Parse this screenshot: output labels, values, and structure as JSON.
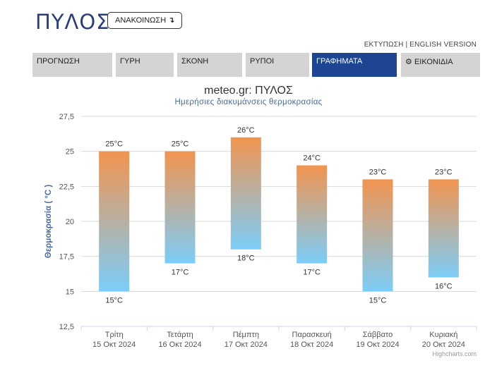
{
  "header": {
    "title": "ΠΥΛΟΣ",
    "announce_label": "ΑΝΑΚΟΙΝΩΣΗ",
    "announce_arrow": "↴"
  },
  "top_links": {
    "print": "ΕΚΤΥΠΩΣΗ",
    "separator": "|",
    "english": "ENGLISH VERSION"
  },
  "tabs": [
    {
      "label": "ΠΡΟΓΝΩΣΗ",
      "active": false
    },
    {
      "label": "ΓΥΡΗ",
      "active": false
    },
    {
      "label": "ΣΚΟΝΗ",
      "active": false
    },
    {
      "label": "ΡΥΠΟΙ",
      "active": false
    },
    {
      "label": "ΓΡΑΦΗΜΑΤΑ",
      "active": true
    },
    {
      "label": "ΕΙΚΟΝΙΔΙΑ",
      "icon": "gear-icon",
      "active": false
    }
  ],
  "chart_data": {
    "type": "columnrange",
    "title": "meteo.gr: ΠΥΛΟΣ",
    "subtitle": "Ημερήσιες διακυμάνσεις θερμοκρασίας",
    "ylabel": "Θερμοκρασία ( °C )",
    "ylim": [
      12.5,
      27.5
    ],
    "yticks": [
      "27,5",
      "25",
      "22,5",
      "20",
      "17,5",
      "15",
      "12,5"
    ],
    "ytick_values": [
      27.5,
      25,
      22.5,
      20,
      17.5,
      15,
      12.5
    ],
    "categories": [
      {
        "day": "Τρίτη",
        "date": "15 Οκτ 2024"
      },
      {
        "day": "Τετάρτη",
        "date": "16 Οκτ 2024"
      },
      {
        "day": "Πέμπτη",
        "date": "17 Οκτ 2024"
      },
      {
        "day": "Παρασκευή",
        "date": "18 Οκτ 2024"
      },
      {
        "day": "Σάββατο",
        "date": "19 Οκτ 2024"
      },
      {
        "day": "Κυριακή",
        "date": "20 Οκτ 2024"
      }
    ],
    "low": [
      15,
      17,
      18,
      17,
      15,
      16
    ],
    "high": [
      25,
      25,
      26,
      24,
      23,
      23
    ],
    "low_labels": [
      "15°C",
      "17°C",
      "18°C",
      "17°C",
      "15°C",
      "16°C"
    ],
    "high_labels": [
      "25°C",
      "25°C",
      "26°C",
      "24°C",
      "23°C",
      "23°C"
    ],
    "colors": {
      "high": "#f2944f",
      "low": "#7ccdf8",
      "grid": "#d8d8d8",
      "axis_title": "#4a6c9e"
    },
    "grid": true,
    "legend": "none"
  },
  "credit": "Highcharts.com"
}
